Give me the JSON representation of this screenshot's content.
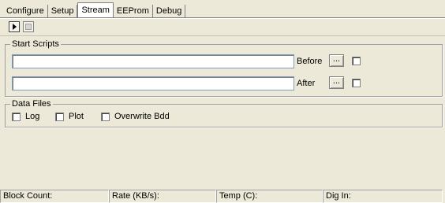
{
  "tabs": [
    {
      "label": "Configure",
      "active": false
    },
    {
      "label": "Setup",
      "active": false
    },
    {
      "label": "Stream",
      "active": true
    },
    {
      "label": "EEProm",
      "active": false
    },
    {
      "label": "Debug",
      "active": false
    }
  ],
  "toolbar": {
    "play_icon": "play-icon",
    "stop_icon": "stop-icon"
  },
  "start_scripts": {
    "legend": "Start Scripts",
    "before": {
      "value": "",
      "label": "Before",
      "browse": "...",
      "checked": false
    },
    "after": {
      "value": "",
      "label": "After",
      "browse": "...",
      "checked": false
    }
  },
  "data_files": {
    "legend": "Data Files",
    "options": [
      {
        "label": "Log",
        "checked": false
      },
      {
        "label": "Plot",
        "checked": false
      },
      {
        "label": "Overwrite Bdd",
        "checked": false
      }
    ]
  },
  "status_bar": {
    "block_count": "Block Count:",
    "rate": "Rate (KB/s):",
    "temp": "Temp (C):",
    "dig_in": "Dig In:"
  }
}
